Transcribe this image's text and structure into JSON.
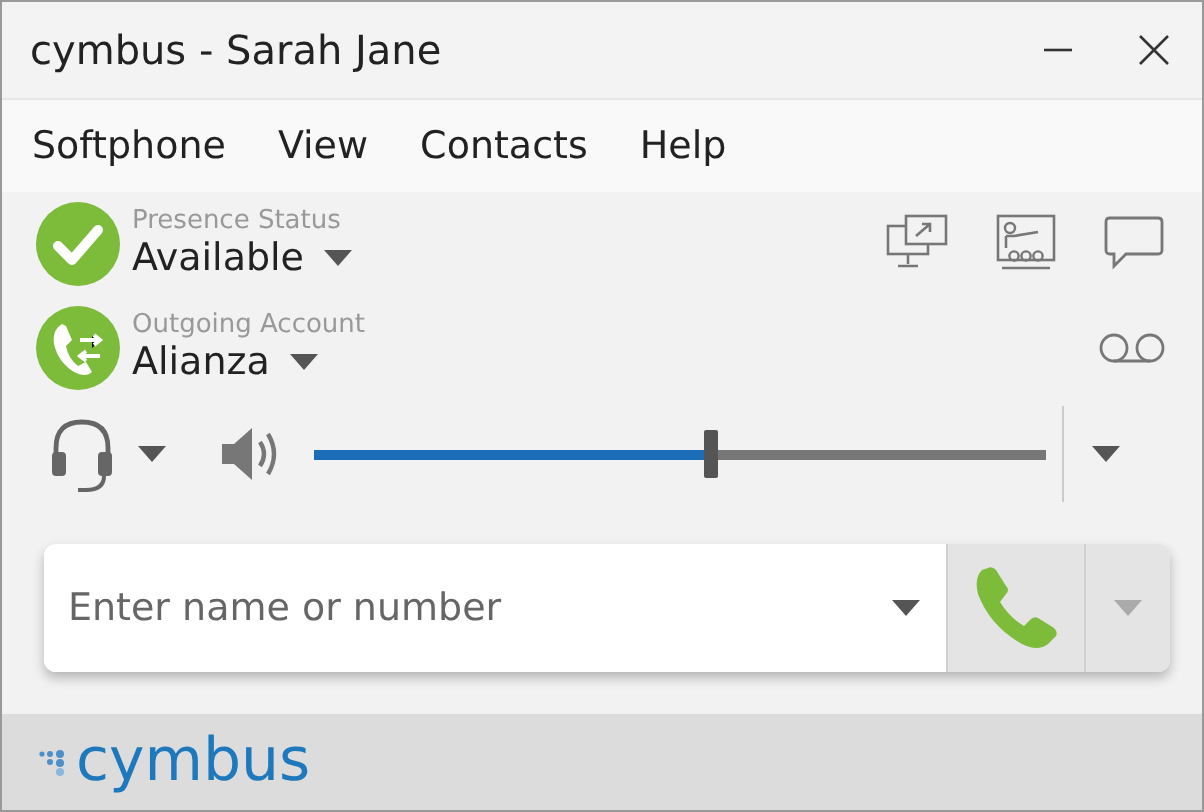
{
  "window": {
    "title": "cymbus - Sarah Jane"
  },
  "menu": [
    "Softphone",
    "View",
    "Contacts",
    "Help"
  ],
  "presence": {
    "label": "Presence Status",
    "value": "Available"
  },
  "account": {
    "label": "Outgoing Account",
    "value": "Alianza"
  },
  "volume": {
    "level": 0.54
  },
  "dial": {
    "placeholder": "Enter name or number"
  },
  "footer": {
    "logo": "cymbus"
  }
}
